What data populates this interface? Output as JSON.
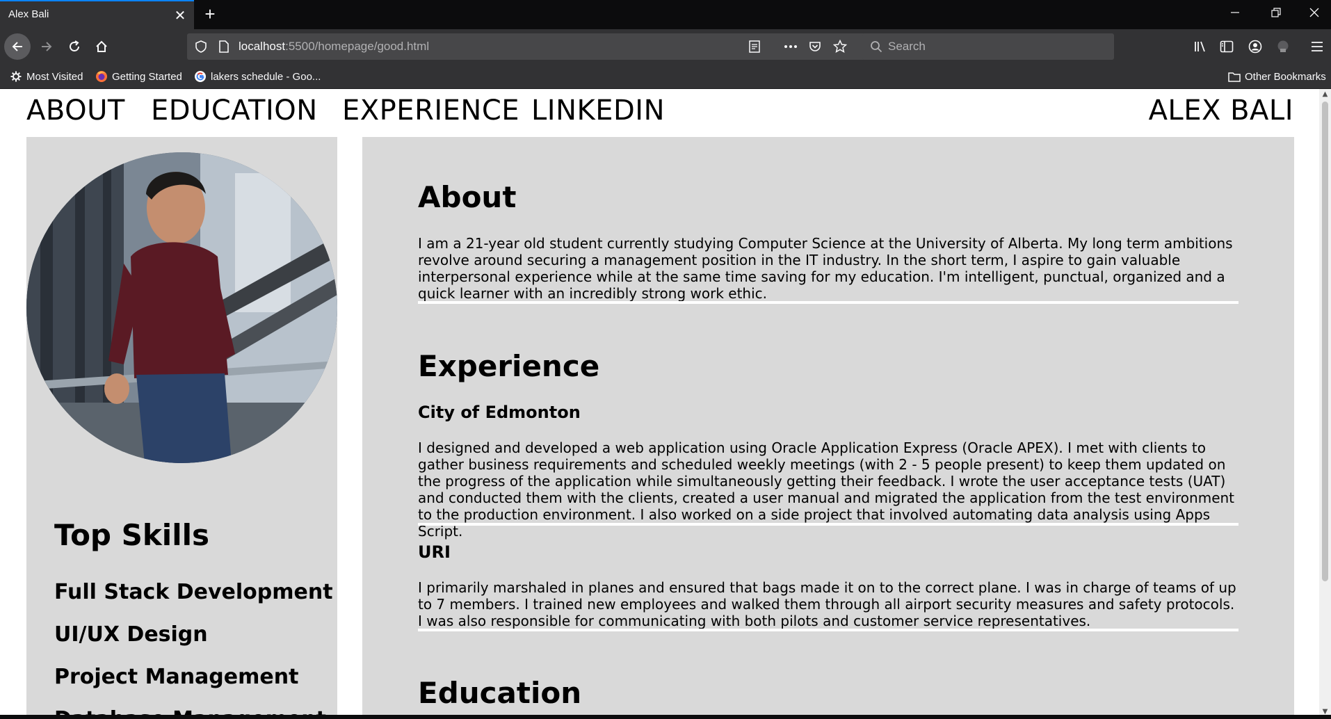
{
  "browser": {
    "tab_title": "Alex Bali",
    "tab_close": "✕",
    "new_tab": "+",
    "url_host": "localhost",
    "url_rest": ":5500/homepage/good.html",
    "search_placeholder": "Search",
    "bookmarks": [
      {
        "label": "Most Visited",
        "icon": "gear-icon"
      },
      {
        "label": "Getting Started",
        "icon": "firefox-icon"
      },
      {
        "label": "lakers schedule - Goo...",
        "icon": "google-icon"
      }
    ],
    "other_bookmarks": "Other Bookmarks"
  },
  "site": {
    "nav": [
      "ABOUT",
      "EDUCATION",
      "EXPERIENCE",
      "LINKEDIN"
    ],
    "name": "ALEX BALI"
  },
  "sidebar": {
    "skills_title": "Top Skills",
    "skills": [
      "Full Stack Development",
      "UI/UX Design",
      "Project Management",
      "Database Management"
    ]
  },
  "about": {
    "title": "About",
    "text": "I am a 21-year old student currently studying Computer Science at the University of Alberta. My long term ambitions revolve around securing a management position in the IT industry. In the short term, I aspire to gain valuable interpersonal experience while at the same time saving for my education. I'm intelligent, punctual, organized and a quick learner with an incredibly strong work ethic."
  },
  "experience": {
    "title": "Experience",
    "jobs": [
      {
        "company": "City of Edmonton",
        "text": "I designed and developed a web application using Oracle Application Express (Oracle APEX). I met with clients to gather business requirements and scheduled weekly meetings (with 2 - 5 people present) to keep them updated on the progress of the application while simultaneously getting their feedback. I wrote the user acceptance tests (UAT) and conducted them with the clients, created a user manual and migrated the application from the test environment to the production environment. I also worked on a side project that involved automating data analysis using Apps Script."
      },
      {
        "company": "URI",
        "text": "I primarily marshaled in planes and ensured that bags made it on to the correct plane. I was in charge of teams of up to 7 members. I trained new employees and walked them through all airport security measures and safety protocols. I was also responsible for communicating with both pilots and customer service representatives."
      }
    ]
  },
  "education": {
    "title": "Education"
  }
}
